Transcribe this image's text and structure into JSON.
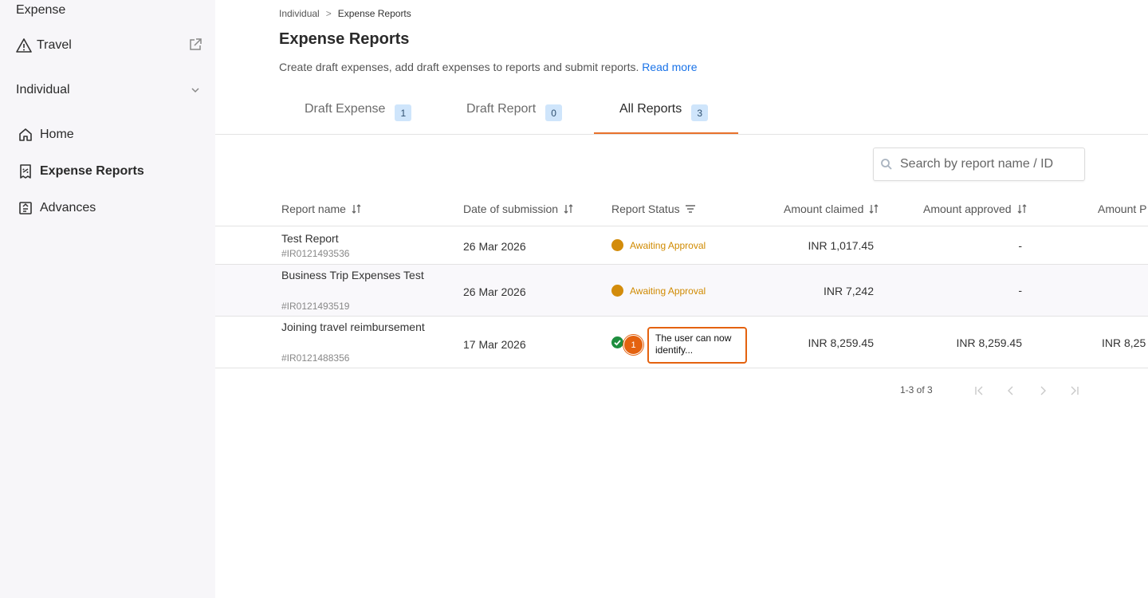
{
  "sidebar": {
    "app_title": "Expense",
    "travel_label": "Travel",
    "section_label": "Individual",
    "items": [
      {
        "label": "Home",
        "active": false
      },
      {
        "label": "Expense Reports",
        "active": true
      },
      {
        "label": "Advances",
        "active": false
      }
    ]
  },
  "breadcrumb": {
    "parent": "Individual",
    "separator": ">",
    "current": "Expense Reports"
  },
  "page": {
    "title": "Expense Reports",
    "description": "Create draft expenses, add draft expenses to reports and submit reports.",
    "read_more": "Read more"
  },
  "tabs": [
    {
      "label": "Draft Expense",
      "count": "1"
    },
    {
      "label": "Draft Report",
      "count": "0"
    },
    {
      "label": "All Reports",
      "count": "3",
      "active": true
    }
  ],
  "search": {
    "placeholder": "Search by report name / ID"
  },
  "table": {
    "headers": {
      "name": "Report name",
      "date": "Date of submission",
      "status": "Report Status",
      "claimed": "Amount claimed",
      "approved": "Amount approved",
      "paid": "Amount P"
    },
    "rows": [
      {
        "name": "Test Report",
        "id": "#IR0121493536",
        "date": "26 Mar 2026",
        "status": "Awaiting Approval",
        "claimed": "INR 1,017.45",
        "approved": "-",
        "paid": ""
      },
      {
        "name": "Business Trip Expenses Test",
        "id": "#IR0121493519",
        "date": "26 Mar 2026",
        "status": "Awaiting Approval",
        "claimed": "INR 7,242",
        "approved": "-",
        "paid": ""
      },
      {
        "name": "Joining travel reimbursement",
        "id": "#IR0121488356",
        "date": "17 Mar 2026",
        "status": "",
        "claimed": "INR 8,259.45",
        "approved": "INR 8,259.45",
        "paid": "INR 8,25"
      }
    ]
  },
  "walkthrough": {
    "step": "1",
    "text": "The user can now identify..."
  },
  "pagination": {
    "info": "1-3 of 3"
  },
  "colors": {
    "accent": "#e8722c",
    "link": "#1a73e8",
    "pending": "#d38c0b",
    "success": "#1e8e3e",
    "badge_bg": "#cfe5fb"
  }
}
